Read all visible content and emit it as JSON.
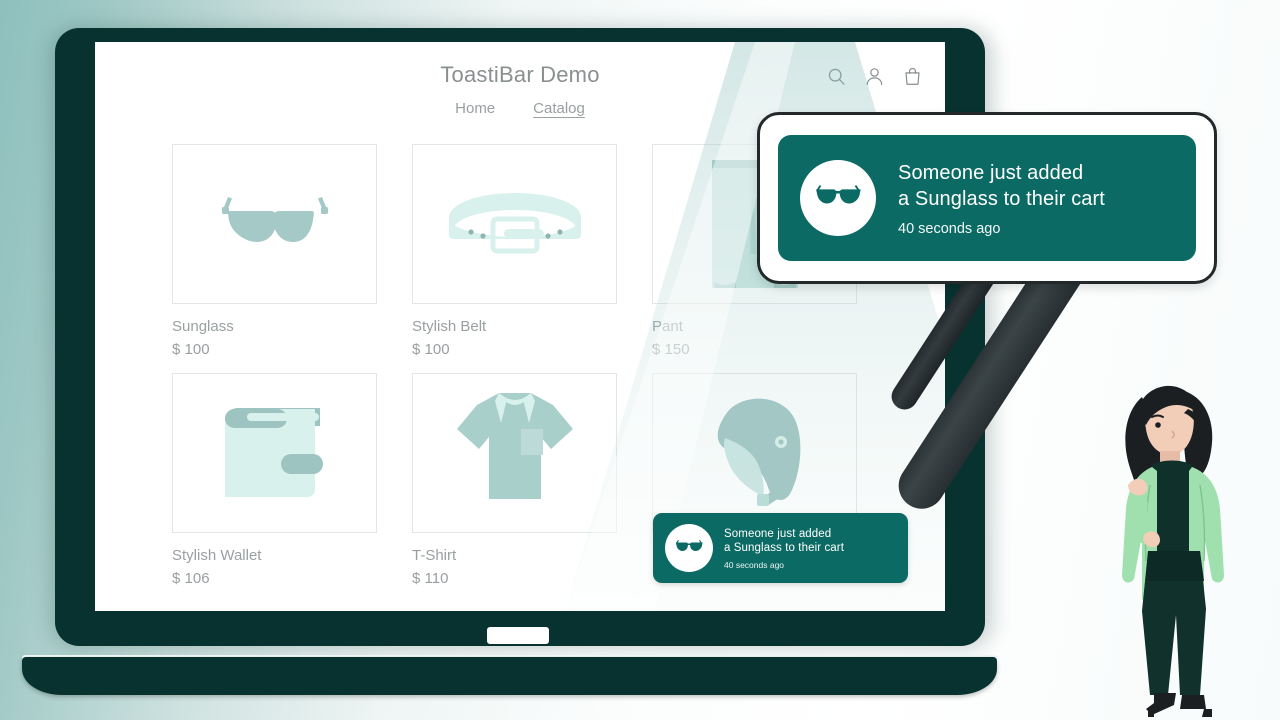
{
  "colors": {
    "background_teal": "#8ec0bd",
    "laptop_frame": "#083230",
    "toast_teal": "#0b6a64",
    "product_teal": "#a4c9c7",
    "product_mint": "#d9f1ec",
    "text_gray": "#9aa0a1",
    "jacket_green": "#9fe0ae",
    "handle_dark": "#2b3336"
  },
  "site": {
    "title": "ToastiBar Demo",
    "nav": [
      {
        "label": "Home",
        "active": false
      },
      {
        "label": "Catalog",
        "active": true
      }
    ],
    "icons": [
      {
        "name": "search-icon",
        "label": "Search"
      },
      {
        "name": "account-icon",
        "label": "Account"
      },
      {
        "name": "shopping-bag-icon",
        "label": "Cart"
      }
    ]
  },
  "products": [
    {
      "name": "Sunglass",
      "price": "$ 100",
      "icon": "sunglasses-icon"
    },
    {
      "name": "Stylish Belt",
      "price": "$ 100",
      "icon": "belt-icon"
    },
    {
      "name": "Pant",
      "price": "$ 150",
      "icon": "pants-icon"
    },
    {
      "name": "Stylish Wallet",
      "price": "$ 106",
      "icon": "wallet-icon"
    },
    {
      "name": "T-Shirt",
      "price": "$ 110",
      "icon": "tshirt-icon"
    },
    {
      "name": "",
      "price": "",
      "icon": "helmet-icon"
    }
  ],
  "toast": {
    "line1": "Someone just added",
    "line2": "a Sunglass to their cart",
    "time": "40 seconds ago",
    "avatar_icon": "sunglasses-icon"
  },
  "magnifier": {
    "name": "magnifying-glass",
    "magnified_toast": {
      "line1": "Someone just added",
      "line2": "a Sunglass to their cart",
      "time": "40 seconds ago"
    }
  }
}
